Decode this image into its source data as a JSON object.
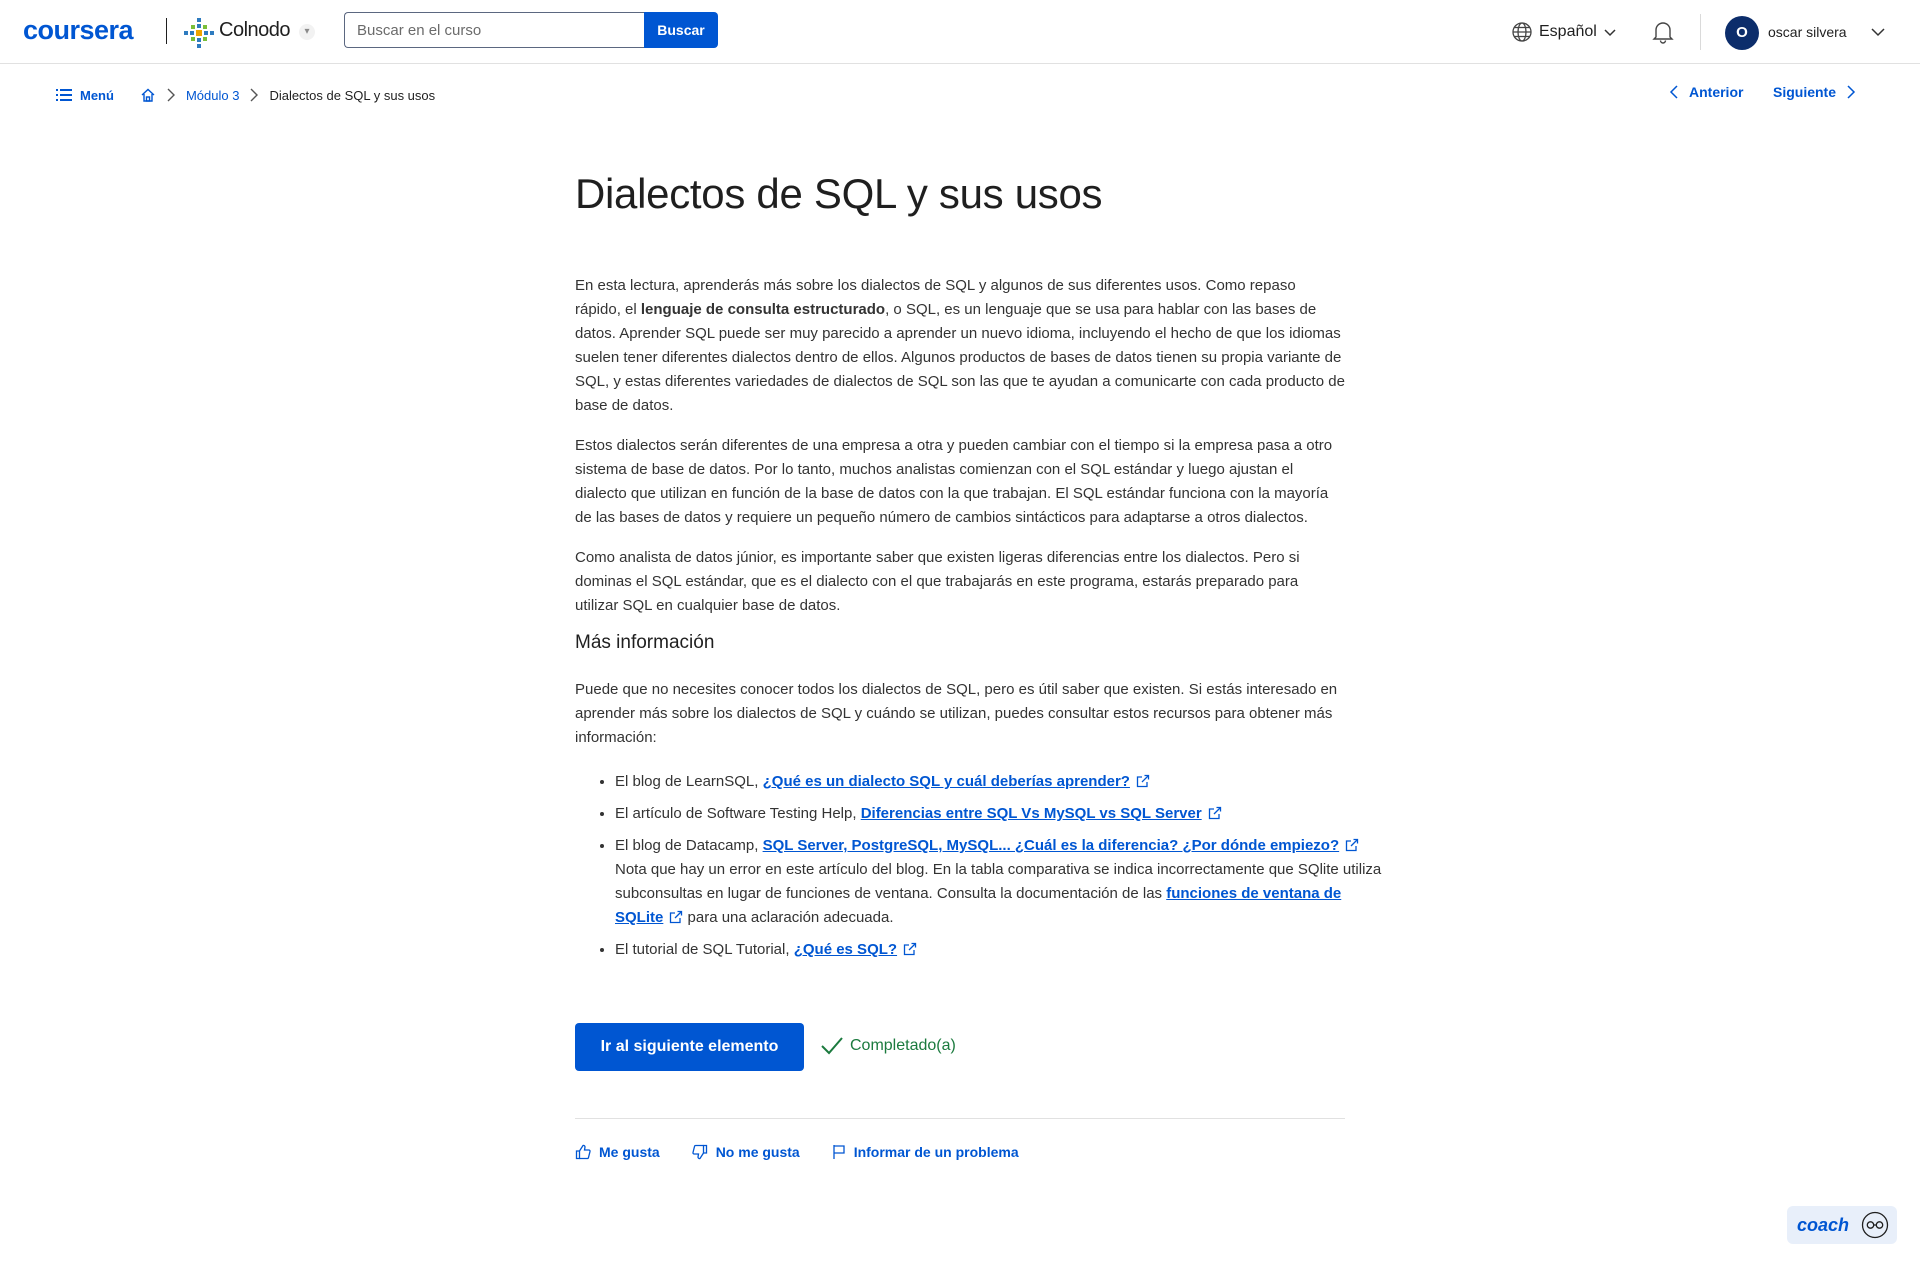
{
  "header": {
    "brand": "coursera",
    "partner": "Colnodo",
    "search": {
      "placeholder": "Buscar en el curso",
      "value": "",
      "button_label": "Buscar"
    },
    "language": "Español",
    "user": {
      "initial": "O",
      "name": "oscar silvera"
    }
  },
  "breadcrumb": {
    "menu_label": "Menú",
    "items": [
      "Módulo 3",
      "Dialectos de SQL y sus usos"
    ]
  },
  "nav": {
    "prev_label": "Anterior",
    "next_label": "Siguiente"
  },
  "article": {
    "title": "Dialectos de SQL y sus usos",
    "p1_a": "En esta lectura, aprenderás más sobre los dialectos de SQL y algunos de sus diferentes usos. Como repaso rápido, el ",
    "p1_bold": "lenguaje de consulta estructurado",
    "p1_b": ", o SQL, es un lenguaje que se usa para hablar con las bases de datos. Aprender SQL puede ser muy parecido a aprender un nuevo idioma, incluyendo el hecho de que los idiomas suelen tener diferentes dialectos dentro de ellos. Algunos productos de bases de datos tienen su propia variante de SQL, y estas diferentes variedades de dialectos de SQL son las que te ayudan a comunicarte con cada producto de base de datos.",
    "p2": "Estos dialectos serán diferentes de una empresa a otra y pueden cambiar con el tiempo si la empresa pasa a otro sistema de base de datos. Por lo tanto, muchos analistas comienzan con el SQL estándar y luego ajustan el dialecto que utilizan en función de la base de datos con la que trabajan. El SQL estándar funciona con la mayoría de las bases de datos y requiere un pequeño número de cambios sintácticos para adaptarse a otros dialectos.",
    "p3": "Como analista de datos júnior, es importante saber que existen ligeras diferencias entre los dialectos. Pero si dominas el SQL estándar, que es el dialecto con el que trabajarás en este programa, estarás preparado para utilizar SQL en cualquier base de datos.",
    "h2": "Más información",
    "p4": "Puede que no necesites conocer todos los dialectos de SQL, pero es útil saber que existen. Si estás interesado en aprender más sobre los dialectos de SQL y cuándo se utilizan, puedes consultar estos recursos para obtener más información:",
    "resources": [
      {
        "prefix": "El blog de LearnSQL, ",
        "link": "¿Qué es un dialecto SQL y cuál deberías aprender?"
      },
      {
        "prefix": "El artículo de Software Testing Help, ",
        "link": "Diferencias entre SQL Vs MySQL vs SQL Server"
      },
      {
        "prefix": "El blog de Datacamp, ",
        "link": "SQL Server, PostgreSQL, MySQL... ¿Cuál es la diferencia? ¿Por dónde empiezo?",
        "note": "Nota que hay un error en este artículo del blog. En la tabla comparativa se indica incorrectamente que SQlite utiliza subconsultas en lugar de funciones de ventana. Consulta la documentación de las ",
        "note_link": "funciones de ventana de SQLite",
        "note_suffix": " para una aclaración adecuada."
      },
      {
        "prefix": "El tutorial de SQL Tutorial, ",
        "link": "¿Qué es SQL?"
      }
    ]
  },
  "actions": {
    "next_item": "Ir al siguiente elemento",
    "completed": "Completado(a)"
  },
  "feedback": {
    "like": "Me gusta",
    "dislike": "No me gusta",
    "report": "Informar de un problema"
  },
  "coach": {
    "label": "coach"
  },
  "colors": {
    "primary": "#0056d2",
    "success": "#1b7a3e",
    "avatar": "#0c2d6b"
  }
}
